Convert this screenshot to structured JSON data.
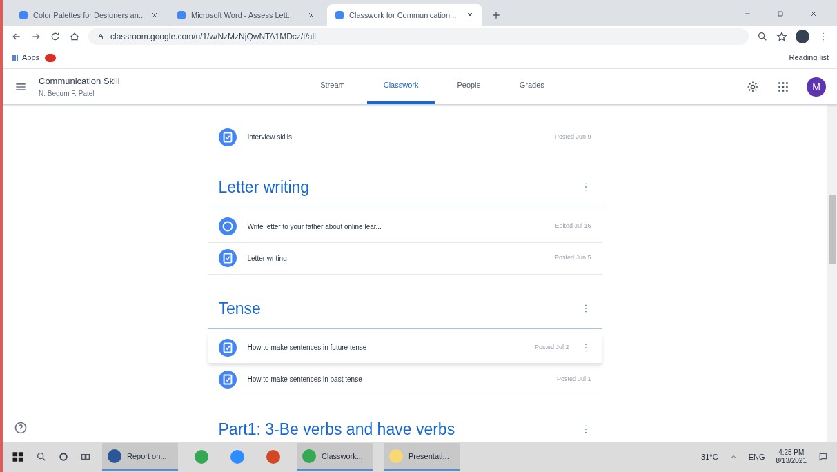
{
  "browser": {
    "tabs": [
      {
        "title": "Color Palettes for Designers an...",
        "selected": false
      },
      {
        "title": "Microsoft Word - Assess Lett...",
        "selected": false
      },
      {
        "title": "Classwork for Communication...",
        "selected": true
      }
    ],
    "url": "classroom.google.com/u/1/w/NzMzNjQwNTA1MDcz/t/all",
    "bookmarks": [
      "Apps"
    ],
    "reading_list": "Reading list"
  },
  "classroom": {
    "class_name": "Communication Skill",
    "teacher": "N. Begum F. Patel",
    "avatar": "M",
    "nav": [
      {
        "label": "Stream",
        "selected": false
      },
      {
        "label": "Classwork",
        "selected": true
      },
      {
        "label": "People",
        "selected": false
      },
      {
        "label": "Grades",
        "selected": false
      }
    ]
  },
  "topics": [
    {
      "items": [
        {
          "kind": "assignment",
          "title": "Interview skills",
          "date": "Posted Jun 9",
          "hovered": false
        }
      ]
    },
    {
      "title": "Letter writing",
      "items": [
        {
          "kind": "question",
          "title": "Write letter to your father about online lear...",
          "date": "Edited Jul 16",
          "hovered": false
        },
        {
          "kind": "assignment",
          "title": "Letter writing",
          "date": "Posted Jun 5",
          "hovered": false
        }
      ]
    },
    {
      "title": "Tense",
      "items": [
        {
          "kind": "assignment",
          "title": "How to make sentences in future tense",
          "date": "Posted Jul 2",
          "hovered": true
        },
        {
          "kind": "assignment",
          "title": "How to make sentences in past tense",
          "date": "Posted Jul 1",
          "hovered": false
        }
      ]
    },
    {
      "title": "Part1: 3-Be verbs and have verbs"
    }
  ],
  "taskbar": {
    "apps": [
      {
        "kind": "word",
        "label": "Report on..."
      },
      {
        "kind": "chrome"
      },
      {
        "kind": "zoom"
      },
      {
        "kind": "powerpoint"
      },
      {
        "kind": "chrome",
        "label": "Classwork..."
      },
      {
        "kind": "folder",
        "label": "Presentati..."
      }
    ],
    "temperature": "31°C",
    "language": "ENG",
    "time": "4:25 PM",
    "date": "8/13/2021"
  }
}
